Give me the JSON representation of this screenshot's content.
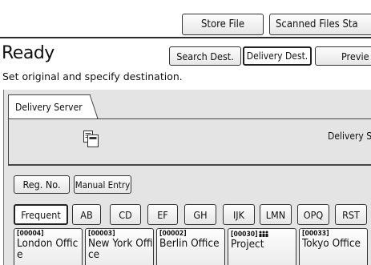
{
  "toolbar": {
    "store_file": "Store File",
    "scanned_files_status": "Scanned Files Sta"
  },
  "status": {
    "title": "Ready",
    "instruction": "Set original and specify destination."
  },
  "dest_buttons": {
    "search_dest": "Search Dest.",
    "delivery_dest": "Delivery Dest.",
    "preview": "Previe"
  },
  "tab": {
    "label": "Delivery Server"
  },
  "server": {
    "label": "Delivery S",
    "icon": "document-icon"
  },
  "actions": {
    "reg_no": "Reg. No.",
    "manual_entry": "Manual Entry"
  },
  "index_tabs": [
    "Frequent",
    "AB",
    "CD",
    "EF",
    "GH",
    "IJK",
    "LMN",
    "OPQ",
    "RST"
  ],
  "entries": [
    {
      "code": "[00004]",
      "name": "London Office",
      "group": false
    },
    {
      "code": "[00003]",
      "name": "New York Office",
      "group": false
    },
    {
      "code": "[00002]",
      "name": "Berlin Office",
      "group": false
    },
    {
      "code": "[00030]",
      "name": "Project",
      "group": true
    },
    {
      "code": "[00033]",
      "name": "Tokyo Office",
      "group": false
    }
  ]
}
